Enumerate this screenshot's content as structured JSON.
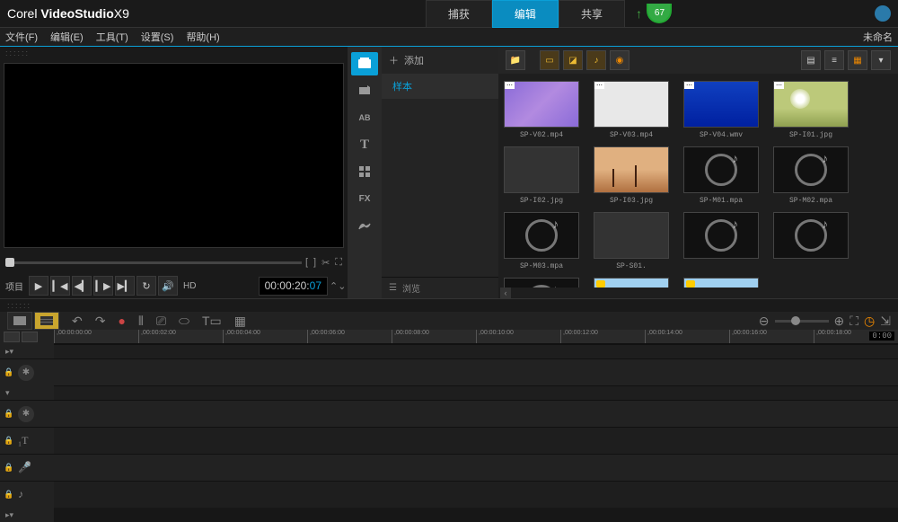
{
  "app": {
    "brand": "Corel",
    "name": "VideoStudio",
    "version": "X9"
  },
  "topnav": {
    "capture": "捕获",
    "edit": "编辑",
    "share": "共享"
  },
  "badge": "67",
  "menus": {
    "file": "文件(F)",
    "edit": "编辑(E)",
    "tools": "工具(T)",
    "settings": "设置(S)",
    "help": "帮助(H)",
    "untitled": "未命名"
  },
  "preview": {
    "project": "项目",
    "hd": "HD",
    "timecode": "00:00:20:",
    "frames": "07"
  },
  "folder": {
    "add": "添加",
    "sample": "样本",
    "browse": "浏览"
  },
  "thumbs": [
    {
      "label": "SP-V02.mp4",
      "kind": "purple"
    },
    {
      "label": "SP-V03.mp4",
      "kind": "blank"
    },
    {
      "label": "SP-V04.wmv",
      "kind": "blue"
    },
    {
      "label": "SP-I01.jpg",
      "kind": "dandelion"
    },
    {
      "label": "SP-I02.jpg",
      "kind": "cut"
    },
    {
      "label": "SP-I03.jpg",
      "kind": "desert"
    },
    {
      "label": "SP-M01.mpa",
      "kind": "audio"
    },
    {
      "label": "SP-M02.mpa",
      "kind": "audio"
    },
    {
      "label": "SP-M03.mpa",
      "kind": "audio"
    },
    {
      "label": "SP-S01.",
      "kind": "cut"
    },
    {
      "label": "",
      "kind": "audio"
    },
    {
      "label": "",
      "kind": "audio"
    },
    {
      "label": "",
      "kind": "audio"
    },
    {
      "label": "",
      "kind": "landscape"
    },
    {
      "label": "",
      "kind": "landscape-cut"
    }
  ],
  "ruler": [
    ",00:00:00:00",
    ",00:00:02:00",
    ",00:00:04:00",
    ",00:00:06:00",
    ",00:00:08:00",
    ",00:00:10:00",
    ",00:00:12:00",
    ",00:00:14:00",
    ",00:00:16:00",
    ",00:00:18:00"
  ],
  "ruler_right": "0:00"
}
